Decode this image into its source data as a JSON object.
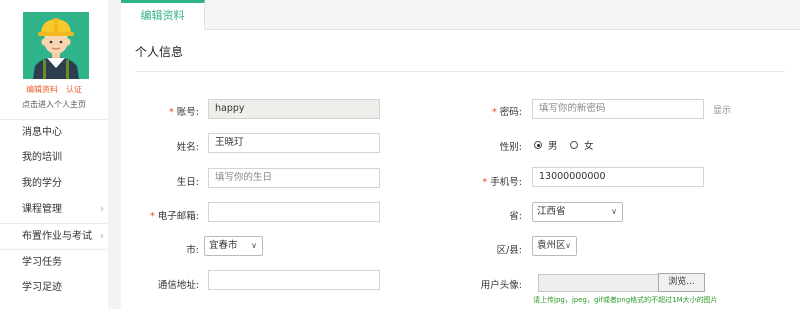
{
  "sidebar": {
    "edit_profile": "编辑资料",
    "verify": "认证",
    "profile_tip": "点击进入个人主页",
    "items": [
      {
        "label": "消息中心",
        "chevron": false
      },
      {
        "label": "我的培训",
        "chevron": false
      },
      {
        "label": "我的学分",
        "chevron": false
      },
      {
        "label": "课程管理",
        "chevron": true
      },
      {
        "label": "布置作业与考试",
        "chevron": true
      },
      {
        "label": "学习任务",
        "chevron": false
      },
      {
        "label": "学习足迹",
        "chevron": false
      }
    ]
  },
  "tab": {
    "label": "编辑资料"
  },
  "section_title": "个人信息",
  "form": {
    "account": {
      "label": "账号:",
      "value": "happy"
    },
    "password": {
      "label": "密码:",
      "placeholder": "填写你的新密码",
      "show": "显示"
    },
    "name": {
      "label": "姓名:",
      "value": "王晓玎"
    },
    "gender": {
      "label": "性别:",
      "male": "男",
      "female": "女",
      "selected": "男"
    },
    "birthday": {
      "label": "生日:",
      "placeholder": "填写你的生日"
    },
    "phone": {
      "label": "手机号:",
      "value": "13000000000"
    },
    "email": {
      "label": "电子邮箱:",
      "value": ""
    },
    "province": {
      "label": "省:",
      "value": "江西省"
    },
    "city": {
      "label": "市:",
      "value": "宜春市"
    },
    "district": {
      "label": "区/县:",
      "value": "袁州区"
    },
    "address": {
      "label": "通信地址:",
      "value": ""
    },
    "avatar": {
      "label": "用户头像:",
      "browse": "浏览...",
      "hint": "请上传jpg，jpeg，gif或者png格式的不超过1M大小的图片"
    }
  },
  "colors": {
    "accent": "#2fb38a",
    "required": "#e8452c",
    "link": "#e8612c"
  }
}
